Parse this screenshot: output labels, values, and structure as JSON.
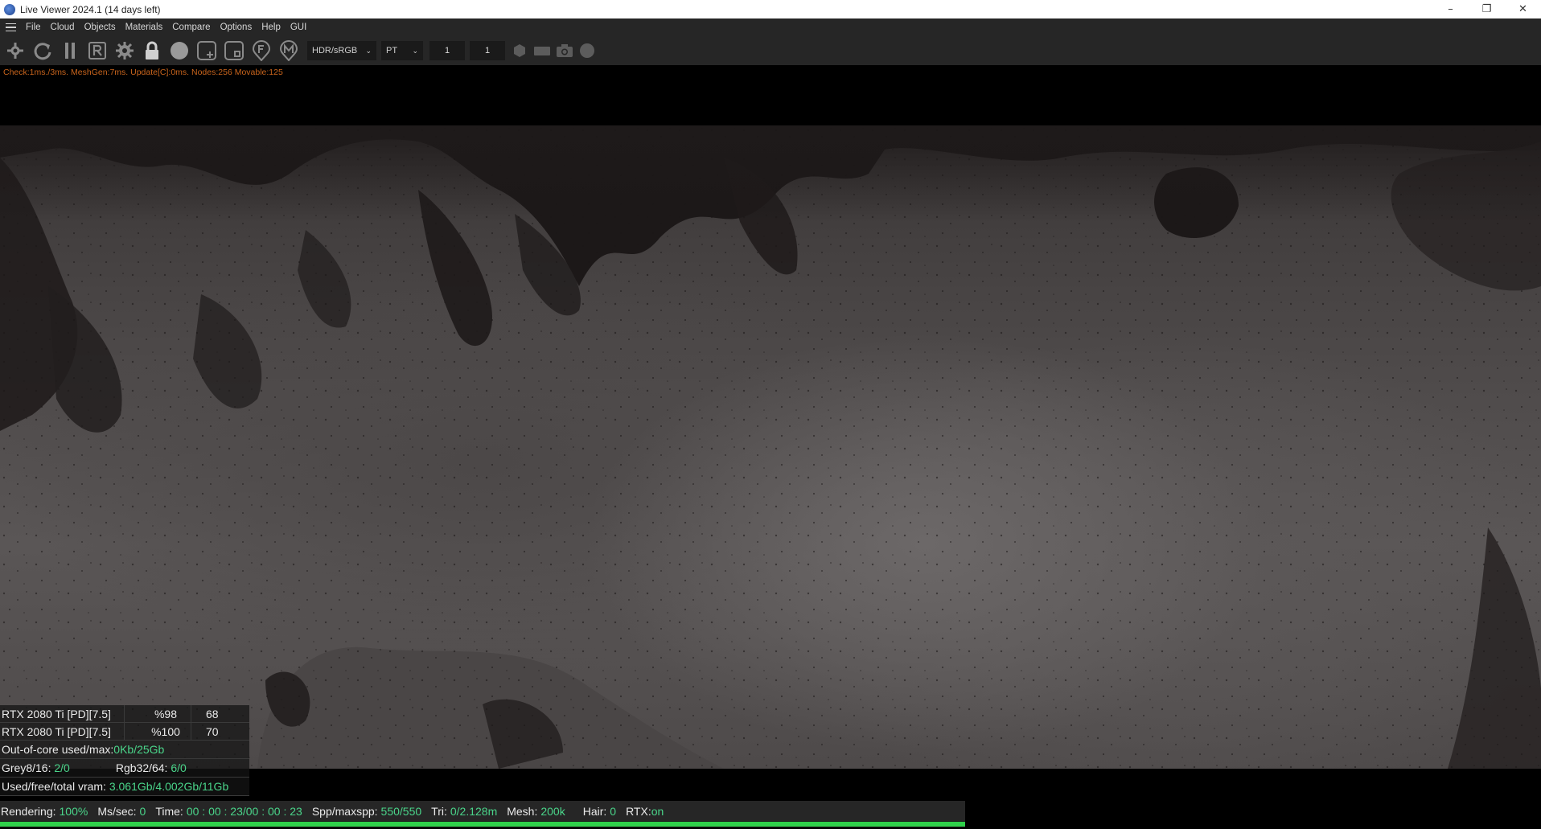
{
  "window": {
    "title": "Live Viewer 2024.1 (14 days left)",
    "minimize": "–",
    "maximize": "❐",
    "close": "✕"
  },
  "menu": {
    "items": [
      "File",
      "Cloud",
      "Objects",
      "Materials",
      "Compare",
      "Options",
      "Help",
      "GUI"
    ]
  },
  "toolbar": {
    "icons": [
      "recenter-icon",
      "refresh-icon",
      "pause-icon",
      "render-r-icon",
      "settings-gear-icon",
      "lock-icon",
      "sphere-icon",
      "add-region-icon",
      "zoom-region-icon",
      "focus-f-icon",
      "material-m-icon"
    ],
    "render_mode": "HDR/sRGB",
    "kernel": "PT",
    "field_a": "1",
    "field_b": "1",
    "tail_icons": [
      "hexagon-icon",
      "film-icon",
      "camera-icon",
      "circle-icon"
    ],
    "chevron": "⌄"
  },
  "stats_line": "Check:1ms./3ms. MeshGen:7ms. Update[C]:0ms. Nodes:256 Movable:125",
  "gpu": {
    "rows": [
      {
        "name": "RTX 2080 Ti [PD][7.5]",
        "usage": "%98",
        "temp": "68"
      },
      {
        "name": "RTX 2080 Ti [PD][7.5]",
        "usage": "%100",
        "temp": "70"
      }
    ],
    "out_of_core_label": "Out-of-core used/max:",
    "out_of_core_value": "0Kb/25Gb",
    "grey_label": "Grey8/16:",
    "grey_value": "2/0",
    "rgb_label": "Rgb32/64:",
    "rgb_value": "6/0",
    "vram_label": "Used/free/total vram:",
    "vram_value": "3.061Gb/4.002Gb/11Gb"
  },
  "status": {
    "rendering_label": "Rendering:",
    "rendering_value": "100%",
    "mssec_label": "Ms/sec:",
    "mssec_value": "0",
    "time_label": "Time:",
    "time_value": "00 : 00 : 23/00 : 00 : 23",
    "spp_label": "Spp/maxspp:",
    "spp_value": "550/550",
    "tri_label": "Tri:",
    "tri_value": "0/2.128m",
    "mesh_label": "Mesh:",
    "mesh_value": "200k",
    "hair_label": "Hair:",
    "hair_value": "0",
    "rtx_label": "RTX:",
    "rtx_value": "on",
    "progress": 1.0
  },
  "colors": {
    "accent_green": "#4ad58a",
    "progress_green": "#2fd04a",
    "stats_orange": "#c8641c",
    "toolbar_bg": "#262626"
  }
}
